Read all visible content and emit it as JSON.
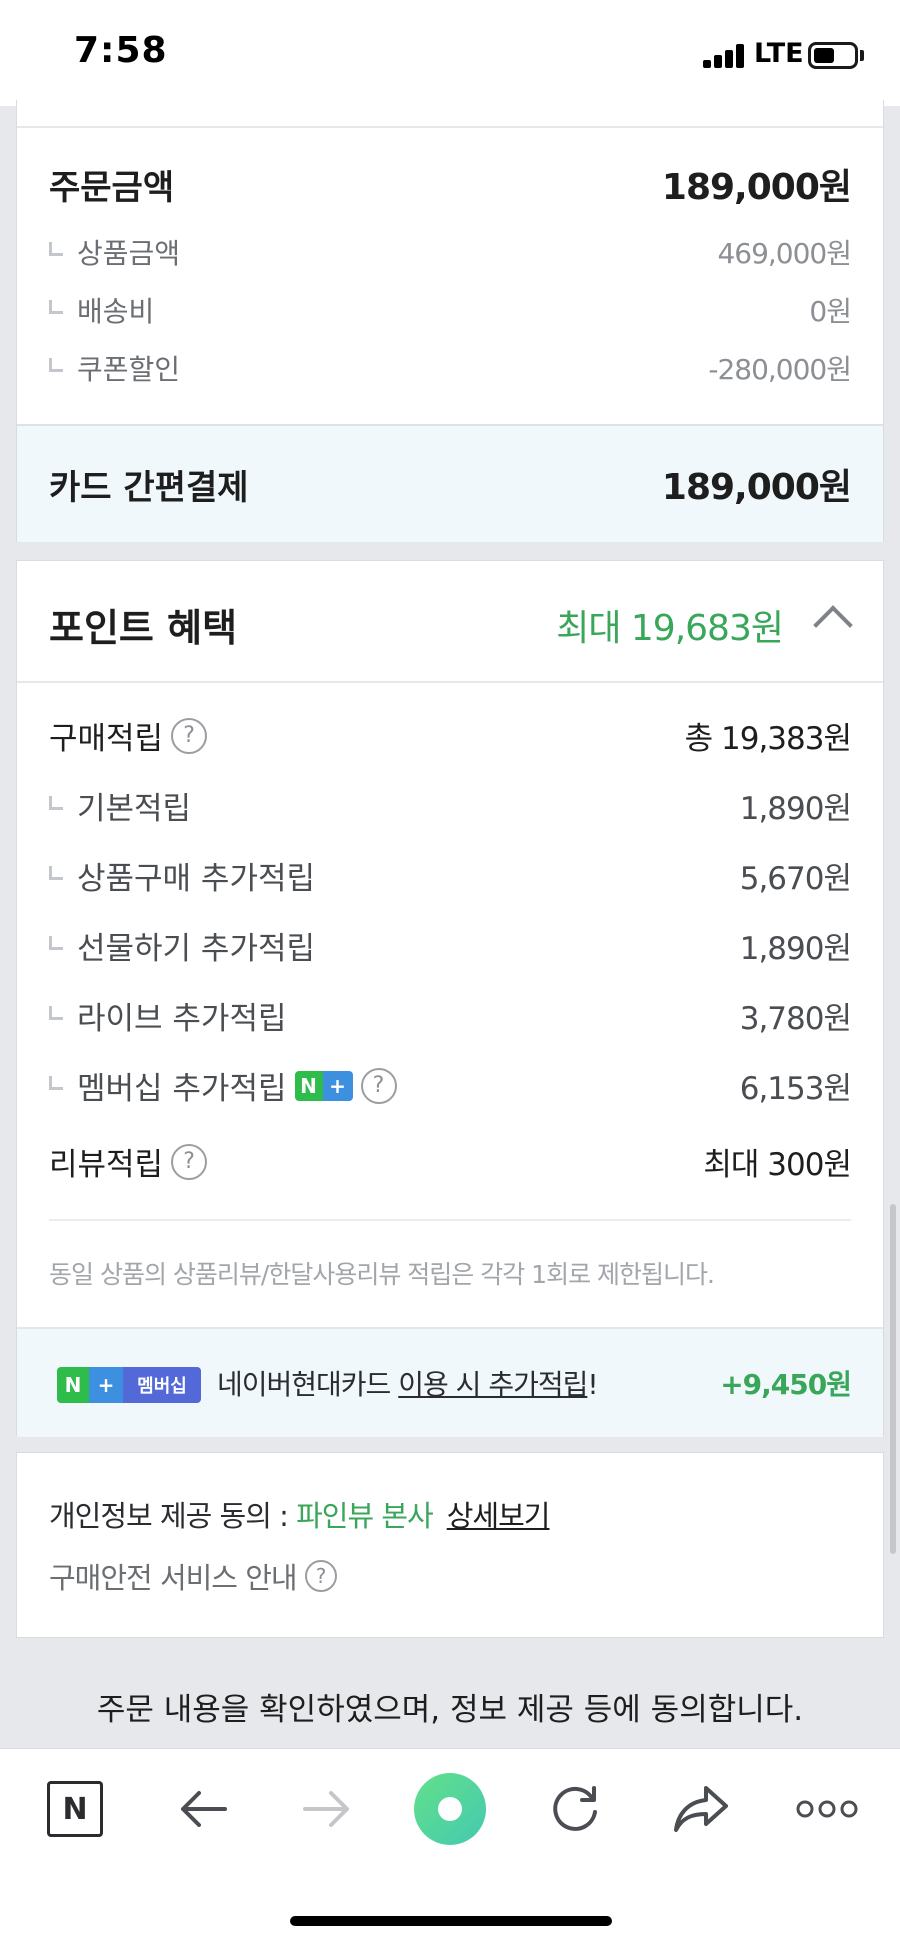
{
  "status": {
    "time": "7:58",
    "network": "LTE"
  },
  "order": {
    "label": "주문금액",
    "total": "189,000원",
    "items": [
      {
        "label": "상품금액",
        "amount": "469,000원"
      },
      {
        "label": "배송비",
        "amount": "0원"
      },
      {
        "label": "쿠폰할인",
        "amount": "-280,000원"
      }
    ],
    "payment_label": "카드 간편결제",
    "payment_amount": "189,000원"
  },
  "points": {
    "title": "포인트 혜택",
    "max": "최대 19,683원",
    "purchase_label": "구매적립",
    "purchase_total": "총 19,383원",
    "sub_items": [
      {
        "label": "기본적립",
        "amount": "1,890원"
      },
      {
        "label": "상품구매 추가적립",
        "amount": "5,670원"
      },
      {
        "label": "선물하기 추가적립",
        "amount": "1,890원"
      },
      {
        "label": "라이브 추가적립",
        "amount": "3,780원"
      },
      {
        "label": "멤버십 추가적립",
        "amount": "6,153원"
      }
    ],
    "review_label": "리뷰적립",
    "review_amount": "최대 300원",
    "notice": "동일 상품의 상품리뷰/한달사용리뷰 적립은 각각 1회로 제한됩니다.",
    "promo_badge_text": "멤버십",
    "promo_text_plain": "네이버현대카드",
    "promo_text_link": "이용 시 추가적립",
    "promo_text_end": "!",
    "promo_amount": "+9,450원"
  },
  "consent": {
    "prefix": "개인정보 제공 동의 : ",
    "company": "파인뷰 본사",
    "link": "상세보기",
    "safe_service": "구매안전 서비스 안내"
  },
  "agree_text": "주문 내용을 확인하였으며, 정보 제공 등에 동의합니다.",
  "colors": {
    "accent_green": "#3aa65a",
    "highlight_bg": "#f1f8fc"
  },
  "bottom_nav": {
    "icons": [
      "naver-n-icon",
      "back-arrow-icon",
      "forward-arrow-icon",
      "green-dot-icon",
      "refresh-icon",
      "share-icon",
      "more-dots-icon"
    ],
    "home_label": "N"
  }
}
